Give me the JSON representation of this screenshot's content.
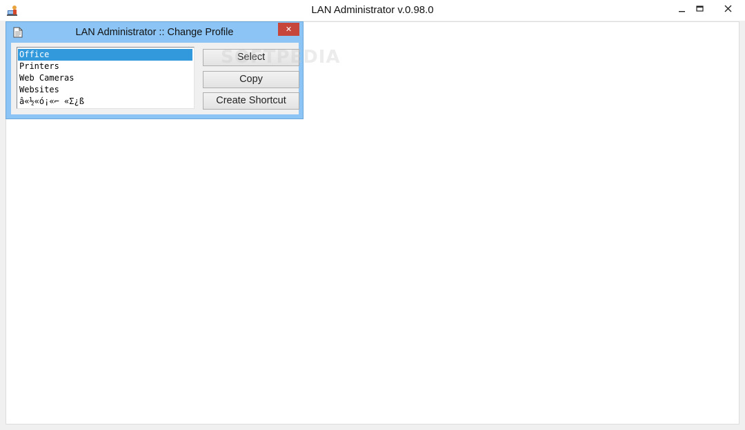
{
  "main_window": {
    "title": "LAN Administrator v.0.98.0",
    "app_icon": "lan-administrator-app-icon",
    "controls": {
      "minimize_icon": "minimize-icon",
      "maximize_icon": "maximize-icon",
      "close_icon": "close-icon"
    }
  },
  "dialog": {
    "title": "LAN Administrator :: Change Profile",
    "icon": "document-icon",
    "close_label": "✕",
    "profiles": [
      {
        "label": "Office",
        "selected": true
      },
      {
        "label": "Printers",
        "selected": false
      },
      {
        "label": "Web Cameras",
        "selected": false
      },
      {
        "label": "Websites",
        "selected": false
      },
      {
        "label": "â«½«ó¡«⌐ «Σ¿ß",
        "selected": false
      }
    ],
    "buttons": {
      "select": "Select",
      "copy": "Copy",
      "create_shortcut": "Create Shortcut"
    }
  },
  "watermark": "SOFTPEDIA",
  "colors": {
    "dialog_frame": "#8cc5f5",
    "selection": "#3399dd",
    "dialog_close": "#c7463b"
  }
}
